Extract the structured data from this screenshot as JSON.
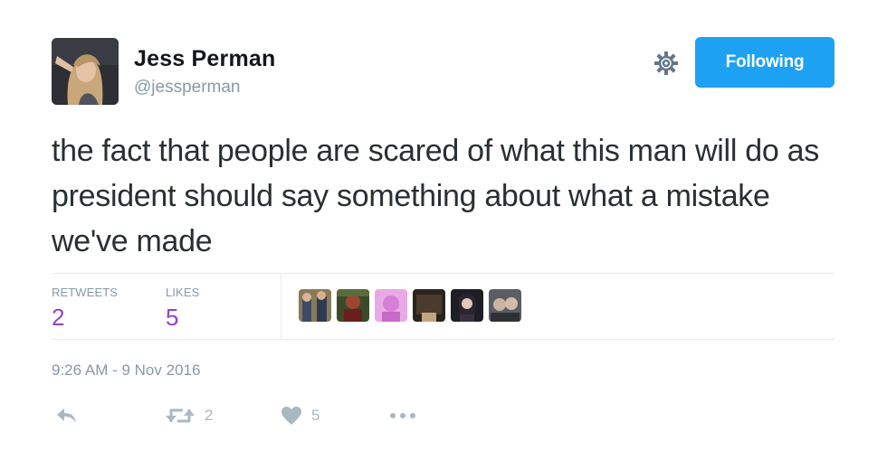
{
  "user": {
    "name": "Jess Perman",
    "handle": "@jessperman"
  },
  "header": {
    "follow_label": "Following",
    "gear_icon": "gear-icon"
  },
  "tweet": {
    "text": "the fact that people are scared of what this man will do as president should say something about what a mistake we've made",
    "timestamp": "9:26 AM - 9 Nov 2016"
  },
  "stats": {
    "retweets_label": "RETWEETS",
    "retweets_value": "2",
    "likes_label": "LIKES",
    "likes_value": "5"
  },
  "likers": [
    {
      "name": "liker-avatar-1"
    },
    {
      "name": "liker-avatar-2"
    },
    {
      "name": "liker-avatar-3"
    },
    {
      "name": "liker-avatar-4"
    },
    {
      "name": "liker-avatar-5"
    },
    {
      "name": "liker-avatar-6"
    }
  ],
  "actions": {
    "reply_icon": "reply-icon",
    "retweet_icon": "retweet-icon",
    "retweet_count": "2",
    "like_icon": "heart-icon",
    "like_count": "5",
    "more_icon": "more-icon"
  },
  "colors": {
    "accent": "#1da1f2",
    "stat_value": "#8e44d0",
    "muted": "#8899a6",
    "icon": "#aab8c2"
  }
}
